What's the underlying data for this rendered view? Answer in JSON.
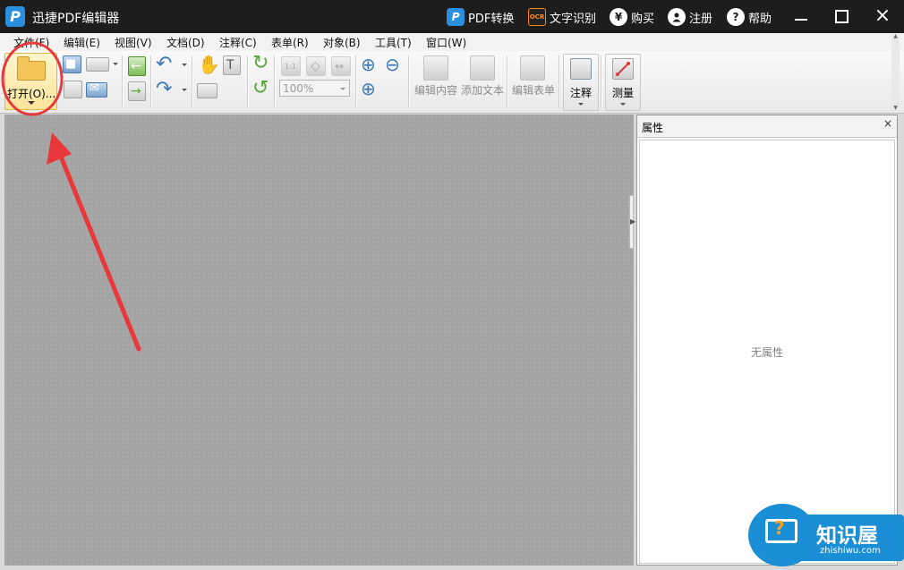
{
  "app": {
    "title": "迅捷PDF编辑器",
    "logo_letter": "P"
  },
  "titlebar": {
    "pdf_convert": "PDF转换",
    "ocr_icon_text": "OCR",
    "ocr": "文字识别",
    "buy": "购买",
    "buy_icon_text": "¥",
    "register": "注册",
    "help": "帮助",
    "help_icon_text": "?"
  },
  "menu": [
    "文件(F)",
    "编辑(E)",
    "视图(V)",
    "文档(D)",
    "注释(C)",
    "表单(R)",
    "对象(B)",
    "工具(T)",
    "窗口(W)"
  ],
  "toolbar": {
    "open_label": "打开(O)...",
    "zoom_value": "100%",
    "edit_content": "编辑内容",
    "add_text": "添加文本",
    "edit_form": "编辑表单",
    "annotate": "注释",
    "measure": "测量",
    "ratio_one": "1:1"
  },
  "panel": {
    "title": "属性",
    "close_symbol": "×",
    "empty_text": "无属性"
  },
  "watermark": {
    "text": "知识屋",
    "url": "zhishiwu.com"
  },
  "colors": {
    "titlebar": "#1d1d1d",
    "accent": "#2b8fe0",
    "annotation": "#e8383b",
    "watermark": "#1a8fd6"
  }
}
